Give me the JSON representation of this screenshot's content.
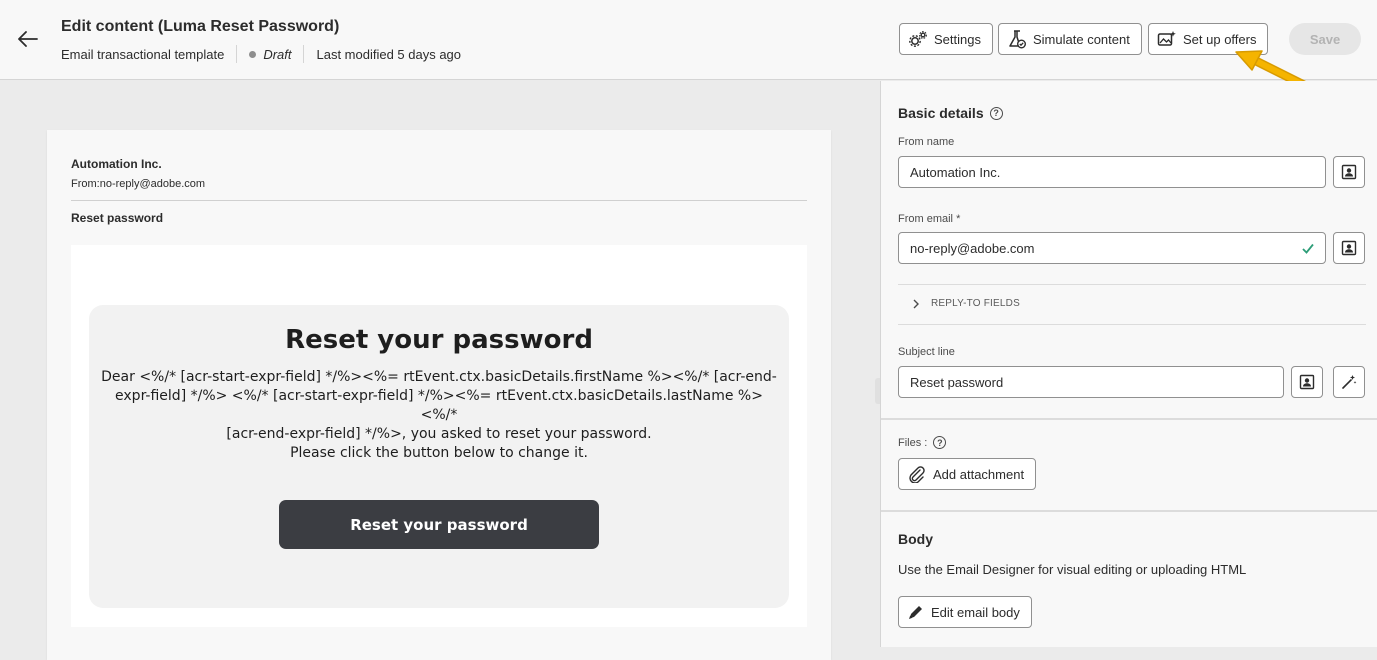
{
  "header": {
    "title": "Edit content (Luma Reset Password)",
    "template_type": "Email transactional template",
    "status": "Draft",
    "last_modified": "Last modified 5 days ago",
    "buttons": {
      "settings": "Settings",
      "simulate": "Simulate content",
      "offers": "Set up offers",
      "save": "Save"
    }
  },
  "preview": {
    "sender_name": "Automation Inc.",
    "from_line": "From:no-reply@adobe.com",
    "subject": "Reset password",
    "heading": "Reset your password",
    "paragraph_line1": "Dear <%/* [acr-start-expr-field] */%><%= rtEvent.ctx.basicDetails.firstName %><%/* [acr-end-",
    "paragraph_line2": "expr-field] */%> <%/* [acr-start-expr-field] */%><%= rtEvent.ctx.basicDetails.lastName %><%/*",
    "paragraph_line3": "[acr-end-expr-field] */%>, you asked to reset your password.",
    "paragraph_line4": "Please click the button below to change it.",
    "button": "Reset your password"
  },
  "panel": {
    "basic_details": "Basic details",
    "from_name_label": "From name",
    "from_name_value": "Automation Inc.",
    "from_email_label": "From email",
    "required_mark": "*",
    "from_email_value": "no-reply@adobe.com",
    "reply_to": "REPLY-TO FIELDS",
    "subject_label": "Subject line",
    "subject_value": "Reset password",
    "files_label": "Files :",
    "add_attachment": "Add attachment",
    "body_title": "Body",
    "body_desc": "Use the Email Designer for visual editing or uploading HTML",
    "edit_body": "Edit email body"
  },
  "colors": {
    "accent_arrow": "#f5b400",
    "valid_check": "#2d9d78",
    "button_dark": "#3b3d42"
  }
}
